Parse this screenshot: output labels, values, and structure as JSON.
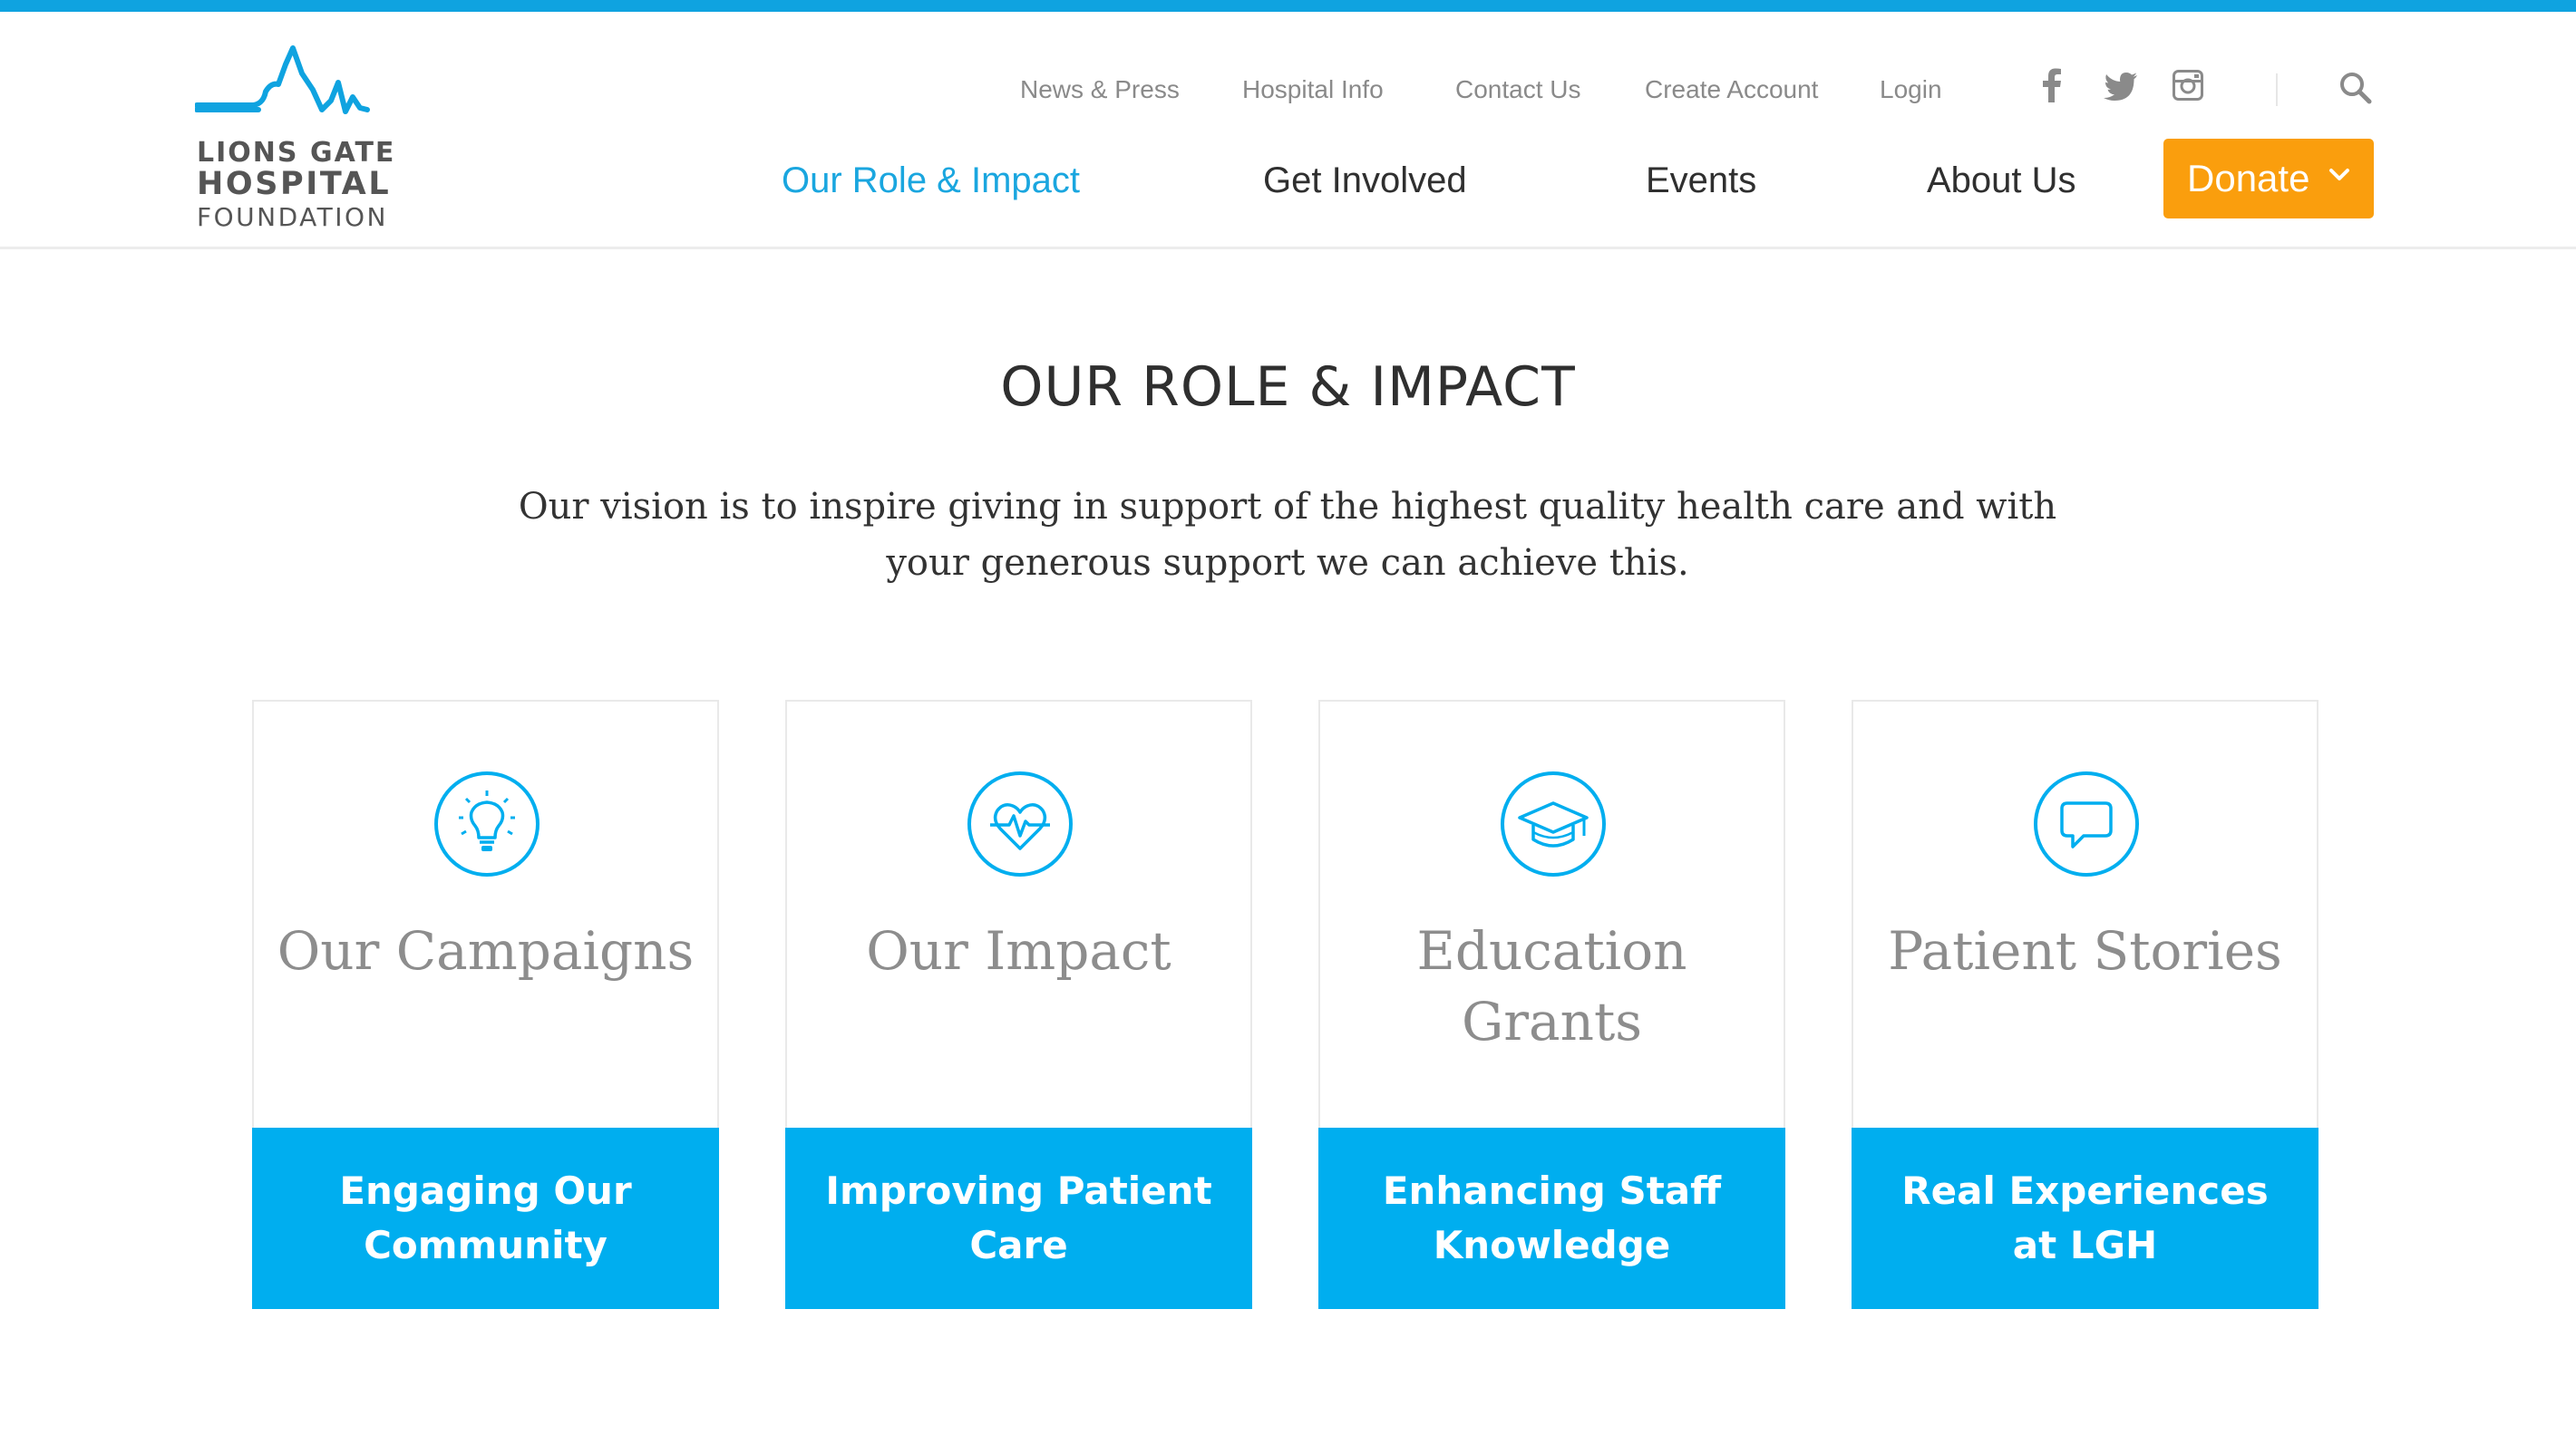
{
  "brand": {
    "line1": "LIONS GATE",
    "line2": "HOSPITAL",
    "line3": "FOUNDATION",
    "color": "#0fa3e0"
  },
  "utility_nav": [
    "News & Press",
    "Hospital Info",
    "Contact Us",
    "Create Account",
    "Login"
  ],
  "social_icons": [
    "facebook-icon",
    "twitter-icon",
    "instagram-icon"
  ],
  "main_nav": {
    "items": [
      "Our Role & Impact",
      "Get Involved",
      "Events",
      "About Us"
    ],
    "active": "Our Role & Impact"
  },
  "donate": {
    "label": "Donate",
    "color": "#fa9e0d"
  },
  "page": {
    "title": "OUR ROLE & IMPACT",
    "intro": "Our vision is to inspire giving in support of the highest quality health care and with your generous support we can achieve this."
  },
  "cards": [
    {
      "icon": "lightbulb-icon",
      "title": "Our Campaigns",
      "subtitle": "Engaging Our Community"
    },
    {
      "icon": "heartbeat-icon",
      "title": "Our Impact",
      "subtitle": "Improving Patient Care"
    },
    {
      "icon": "graduation-cap-icon",
      "title": "Education Grants",
      "subtitle": "Enhancing Staff Knowledge"
    },
    {
      "icon": "speech-bubble-icon",
      "title": "Patient Stories",
      "subtitle": "Real Experiences at LGH"
    }
  ],
  "colors": {
    "accent": "#00aeef",
    "text_dark": "#2f2f2f",
    "text_muted": "#8d8d8d"
  }
}
